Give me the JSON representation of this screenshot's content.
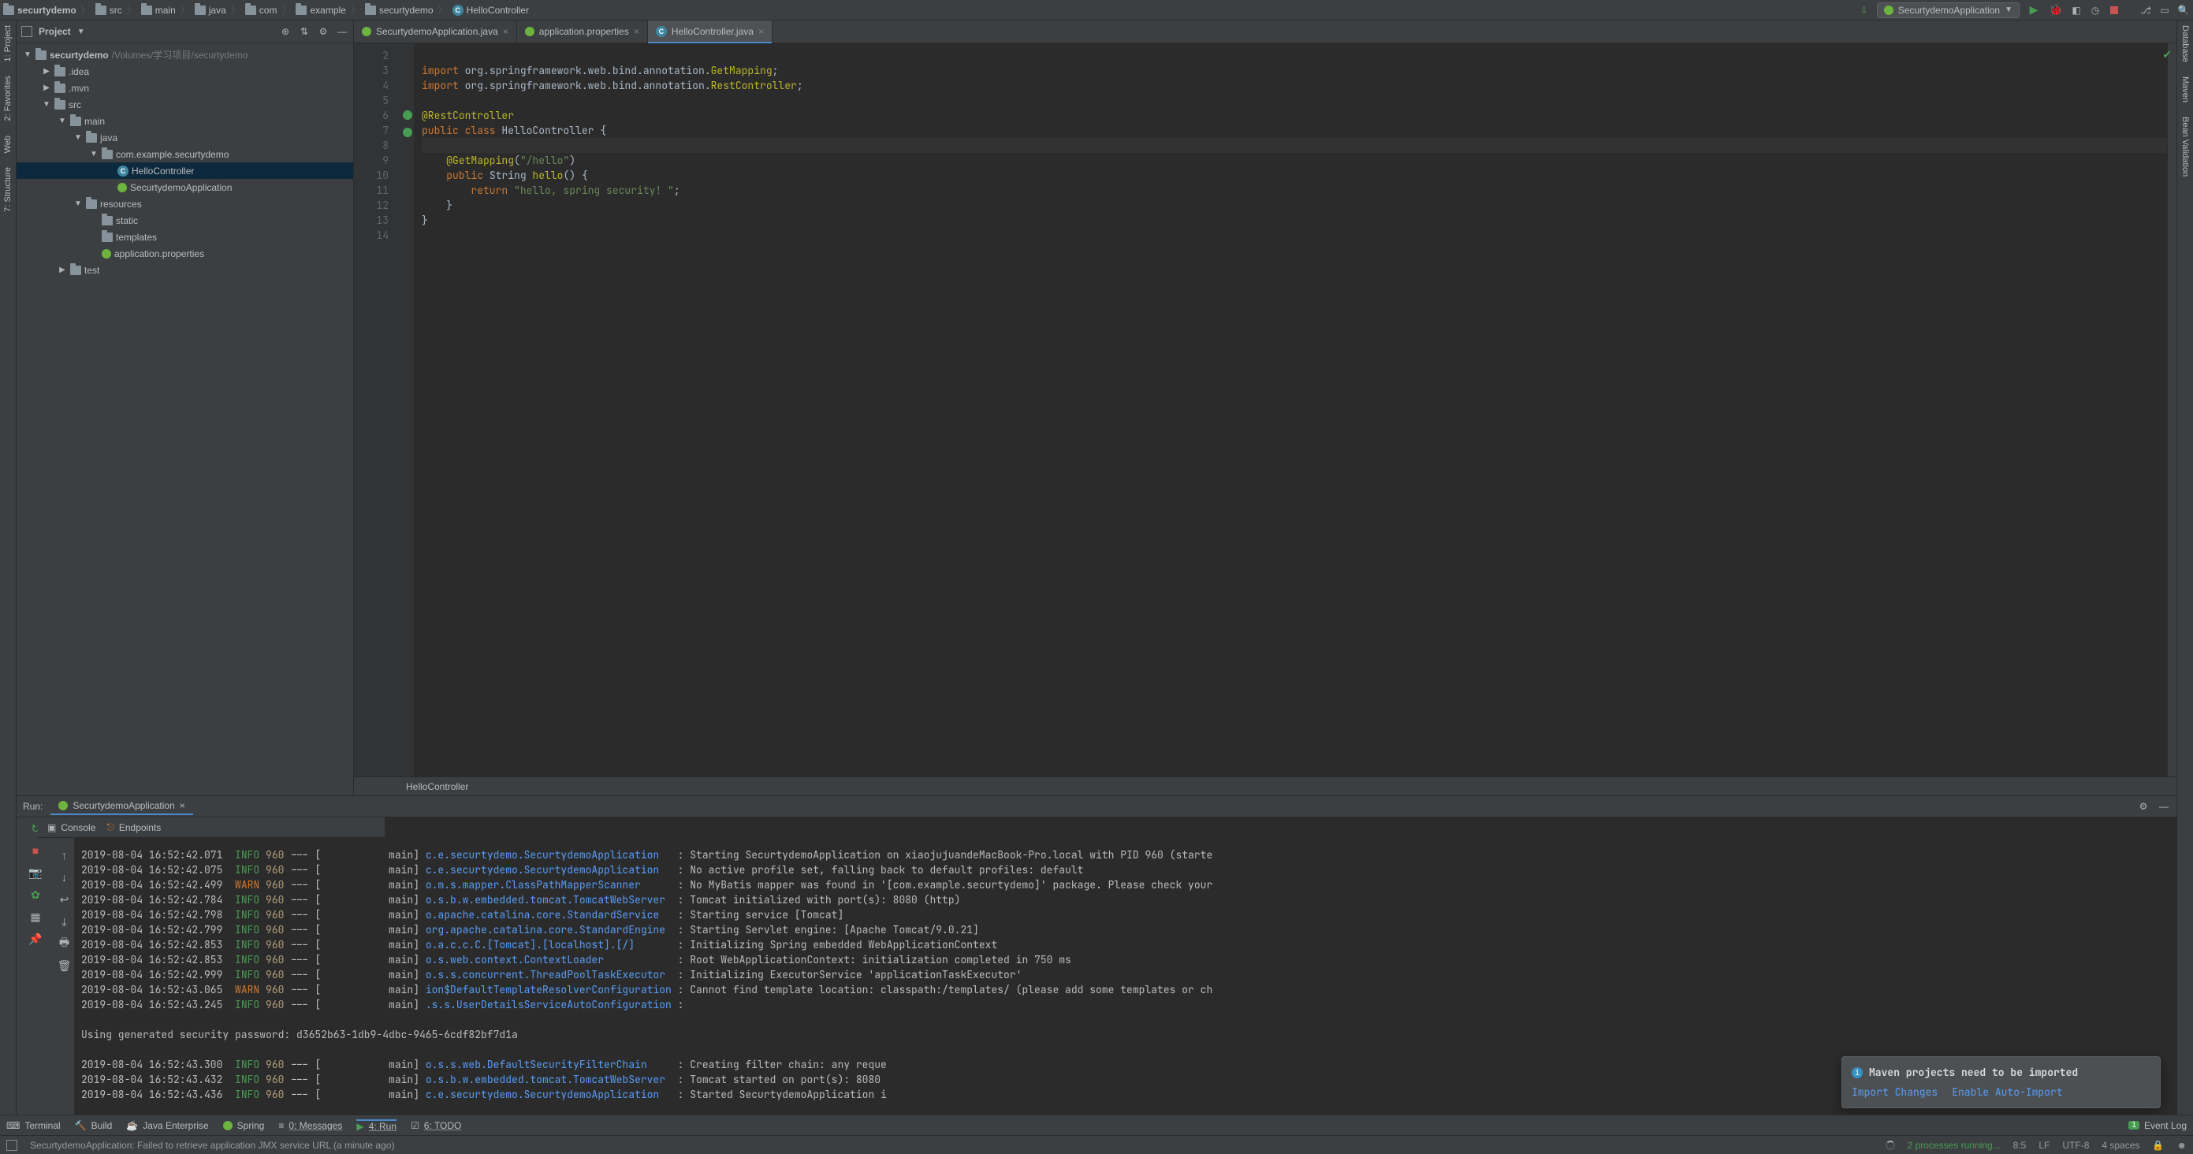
{
  "breadcrumbs": [
    "securtydemo",
    "src",
    "main",
    "java",
    "com",
    "example",
    "securtydemo",
    "HelloController"
  ],
  "runConfig": "SecurtydemoApplication",
  "projectPanel": {
    "title": "Project",
    "rootName": "securtydemo",
    "rootPath": "/Volumes/学习项目/securtydemo",
    "tree": [
      {
        "indent": 1,
        "arrow": "▶",
        "icon": "folder",
        "label": ".idea"
      },
      {
        "indent": 1,
        "arrow": "▶",
        "icon": "folder",
        "label": ".mvn"
      },
      {
        "indent": 1,
        "arrow": "▼",
        "icon": "folder",
        "label": "src"
      },
      {
        "indent": 2,
        "arrow": "▼",
        "icon": "folder",
        "label": "main"
      },
      {
        "indent": 3,
        "arrow": "▼",
        "icon": "folder",
        "label": "java"
      },
      {
        "indent": 4,
        "arrow": "▼",
        "icon": "folder",
        "label": "com.example.securtydemo"
      },
      {
        "indent": 5,
        "arrow": "",
        "icon": "class",
        "label": "HelloController",
        "selected": true
      },
      {
        "indent": 5,
        "arrow": "",
        "icon": "spring",
        "label": "SecurtydemoApplication"
      },
      {
        "indent": 3,
        "arrow": "▼",
        "icon": "folder",
        "label": "resources"
      },
      {
        "indent": 4,
        "arrow": "",
        "icon": "folder",
        "label": "static"
      },
      {
        "indent": 4,
        "arrow": "",
        "icon": "folder",
        "label": "templates"
      },
      {
        "indent": 4,
        "arrow": "",
        "icon": "spring",
        "label": "application.properties"
      },
      {
        "indent": 2,
        "arrow": "▶",
        "icon": "folder",
        "label": "test"
      }
    ]
  },
  "editorTabs": [
    {
      "icon": "spring",
      "label": "SecurtydemoApplication.java",
      "active": false
    },
    {
      "icon": "spring",
      "label": "application.properties",
      "active": false
    },
    {
      "icon": "class",
      "label": "HelloController.java",
      "active": true
    }
  ],
  "code": {
    "lineStart": 2,
    "caretLine": 8,
    "lines": [
      {
        "n": 2,
        "html": ""
      },
      {
        "n": 3,
        "html": "<span class='kw'>import</span> org.springframework.web.bind.annotation.<span class='ann'>GetMapping</span>;"
      },
      {
        "n": 4,
        "html": "<span class='kw'>import</span> org.springframework.web.bind.annotation.<span class='ann'>RestController</span>;"
      },
      {
        "n": 5,
        "html": ""
      },
      {
        "n": 6,
        "html": "<span class='ann'>@RestController</span>",
        "marker": true
      },
      {
        "n": 7,
        "html": "<span class='kw'>public class</span> <span class='cls'>HelloController</span> {",
        "marker": true
      },
      {
        "n": 8,
        "html": "    "
      },
      {
        "n": 9,
        "html": "    <span class='ann'>@GetMapping</span>(<span class='str'>\"/hello\"</span>)"
      },
      {
        "n": 10,
        "html": "    <span class='kw'>public</span> String <span class='ann'>hello</span>() {"
      },
      {
        "n": 11,
        "html": "        <span class='kw'>return</span> <span class='str'>\"hello, spring security! \"</span>;"
      },
      {
        "n": 12,
        "html": "    }"
      },
      {
        "n": 13,
        "html": "}"
      },
      {
        "n": 14,
        "html": ""
      }
    ],
    "breadcrumb": "HelloController"
  },
  "runPanel": {
    "title": "Run:",
    "tab": "SecurtydemoApplication",
    "subtabs": [
      "Console",
      "Endpoints"
    ],
    "activeSubtab": "Console",
    "logs": [
      {
        "ts": "2019-08-04 16:52:42.071",
        "lvl": "INFO",
        "pid": "960",
        "thread": "main",
        "logger": "c.e.securtydemo.SecurtydemoApplication",
        "msg": "Starting SecurtydemoApplication on xiaojujuandeMacBook-Pro.local with PID 960 (starte"
      },
      {
        "ts": "2019-08-04 16:52:42.075",
        "lvl": "INFO",
        "pid": "960",
        "thread": "main",
        "logger": "c.e.securtydemo.SecurtydemoApplication",
        "msg": "No active profile set, falling back to default profiles: default"
      },
      {
        "ts": "2019-08-04 16:52:42.499",
        "lvl": "WARN",
        "pid": "960",
        "thread": "main",
        "logger": "o.m.s.mapper.ClassPathMapperScanner",
        "msg": "No MyBatis mapper was found in '[com.example.securtydemo]' package. Please check your"
      },
      {
        "ts": "2019-08-04 16:52:42.784",
        "lvl": "INFO",
        "pid": "960",
        "thread": "main",
        "logger": "o.s.b.w.embedded.tomcat.TomcatWebServer",
        "msg": "Tomcat initialized with port(s): 8080 (http)"
      },
      {
        "ts": "2019-08-04 16:52:42.798",
        "lvl": "INFO",
        "pid": "960",
        "thread": "main",
        "logger": "o.apache.catalina.core.StandardService",
        "msg": "Starting service [Tomcat]"
      },
      {
        "ts": "2019-08-04 16:52:42.799",
        "lvl": "INFO",
        "pid": "960",
        "thread": "main",
        "logger": "org.apache.catalina.core.StandardEngine",
        "msg": "Starting Servlet engine: [Apache Tomcat/9.0.21]"
      },
      {
        "ts": "2019-08-04 16:52:42.853",
        "lvl": "INFO",
        "pid": "960",
        "thread": "main",
        "logger": "o.a.c.c.C.[Tomcat].[localhost].[/]",
        "msg": "Initializing Spring embedded WebApplicationContext"
      },
      {
        "ts": "2019-08-04 16:52:42.853",
        "lvl": "INFO",
        "pid": "960",
        "thread": "main",
        "logger": "o.s.web.context.ContextLoader",
        "msg": "Root WebApplicationContext: initialization completed in 750 ms"
      },
      {
        "ts": "2019-08-04 16:52:42.999",
        "lvl": "INFO",
        "pid": "960",
        "thread": "main",
        "logger": "o.s.s.concurrent.ThreadPoolTaskExecutor",
        "msg": "Initializing ExecutorService 'applicationTaskExecutor'"
      },
      {
        "ts": "2019-08-04 16:52:43.065",
        "lvl": "WARN",
        "pid": "960",
        "thread": "main",
        "logger": "ion$DefaultTemplateResolverConfiguration",
        "msg": "Cannot find template location: classpath:/templates/ (please add some templates or ch"
      },
      {
        "ts": "2019-08-04 16:52:43.245",
        "lvl": "INFO",
        "pid": "960",
        "thread": "main",
        "logger": ".s.s.UserDetailsServiceAutoConfiguration",
        "msg": ""
      }
    ],
    "extraLine1": "",
    "extraLine2": "Using generated security password: d3652b63-1db9-4dbc-9465-6cdf82bf7d1a",
    "logs2": [
      {
        "ts": "2019-08-04 16:52:43.300",
        "lvl": "INFO",
        "pid": "960",
        "thread": "main",
        "logger": "o.s.s.web.DefaultSecurityFilterChain",
        "msg": "Creating filter chain: any reque"
      },
      {
        "ts": "2019-08-04 16:52:43.432",
        "lvl": "INFO",
        "pid": "960",
        "thread": "main",
        "logger": "o.s.b.w.embedded.tomcat.TomcatWebServer",
        "msg": "Tomcat started on port(s): 8080"
      },
      {
        "ts": "2019-08-04 16:52:43.436",
        "lvl": "INFO",
        "pid": "960",
        "thread": "main",
        "logger": "c.e.securtydemo.SecurtydemoApplication",
        "msg": "Started SecurtydemoApplication i"
      }
    ]
  },
  "mavenPopup": {
    "title": "Maven projects need to be imported",
    "link1": "Import Changes",
    "link2": "Enable Auto-Import"
  },
  "bottomTools": {
    "terminal": "Terminal",
    "build": "Build",
    "javaee": "Java Enterprise",
    "spring": "Spring",
    "messages": "0: Messages",
    "run": "4: Run",
    "todo": "6: TODO",
    "eventLog": "Event Log",
    "eventBadge": "1"
  },
  "statusBar": {
    "message": "SecurtydemoApplication: Failed to retrieve application JMX service URL (a minute ago)",
    "processes": "2 processes running...",
    "pos": "8:5",
    "lineSep": "LF",
    "encoding": "UTF-8",
    "indent": "4 spaces"
  },
  "leftGutter": [
    "1: Project",
    "2: Favorites",
    "Web",
    "7: Structure"
  ],
  "rightGutter": [
    "Database",
    "Maven",
    "Bean Validation"
  ]
}
